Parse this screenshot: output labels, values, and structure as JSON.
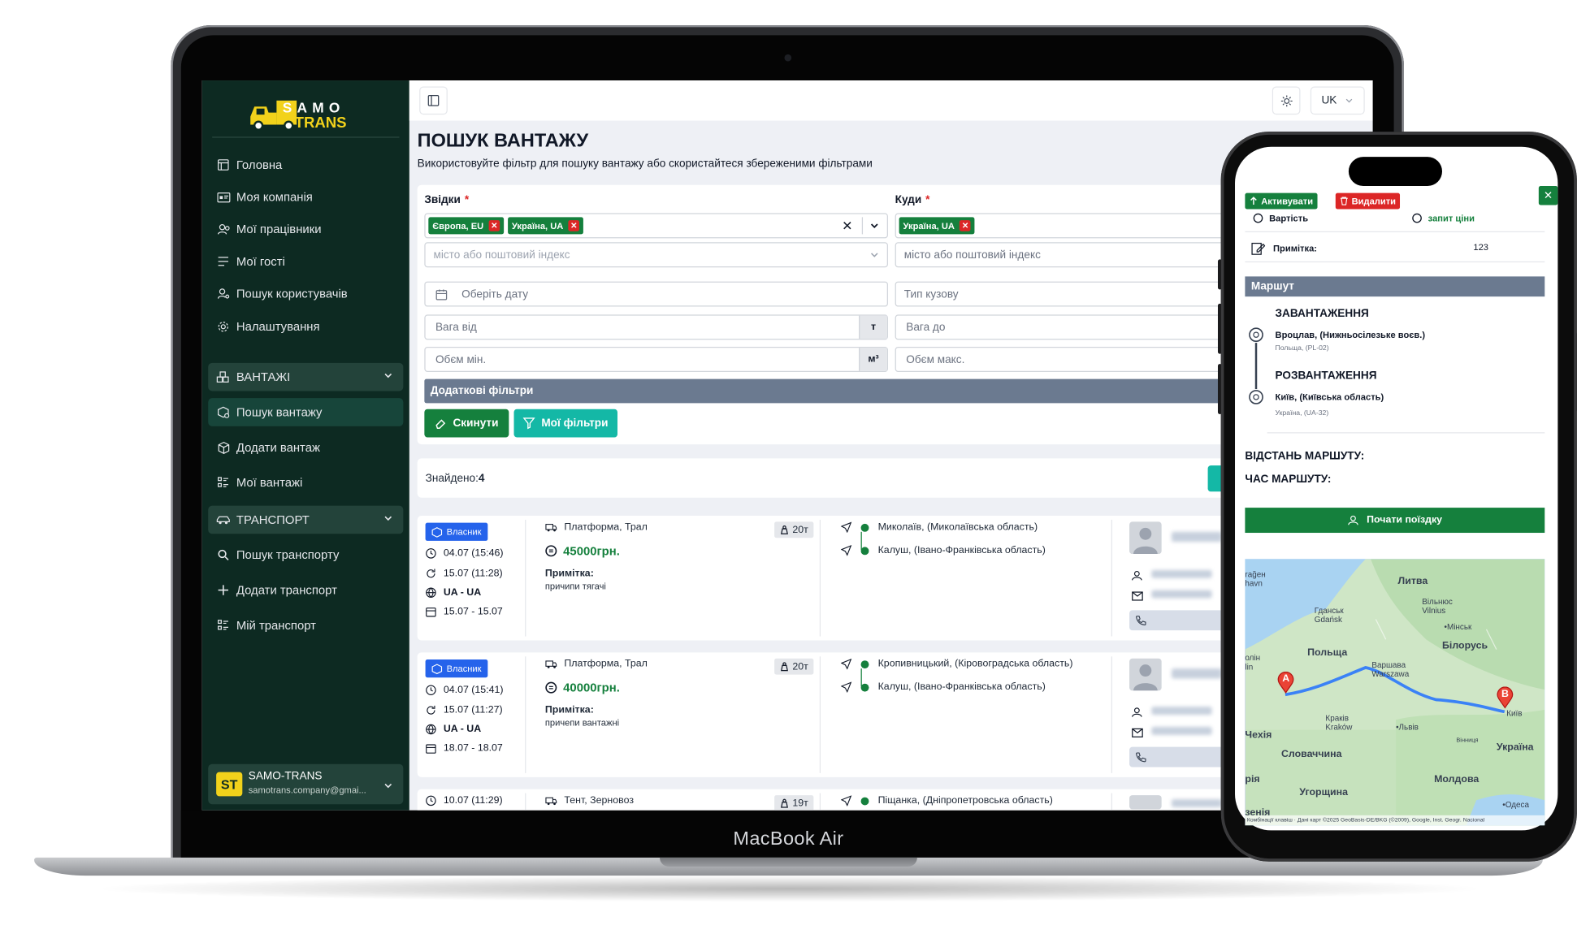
{
  "device": {
    "laptop_label": "MacBook Air"
  },
  "brand": {
    "line1": "SAMO",
    "line2": "TRANS"
  },
  "sidebar": {
    "items": [
      {
        "label": "Головна",
        "icon": "home-icon"
      },
      {
        "label": "Моя компанія",
        "icon": "id-card-icon"
      },
      {
        "label": "Мої працівники",
        "icon": "users-icon"
      },
      {
        "label": "Мої гості",
        "icon": "list-icon"
      },
      {
        "label": "Пошук користувачів",
        "icon": "user-search-icon"
      },
      {
        "label": "Налаштування",
        "icon": "gear-icon"
      }
    ],
    "groups": [
      {
        "label": "ВАНТАЖІ",
        "items": [
          {
            "label": "Пошук вантажу",
            "icon": "box-search-icon",
            "active": true
          },
          {
            "label": "Додати вантаж",
            "icon": "box-icon"
          },
          {
            "label": "Мої вантажі",
            "icon": "list-icon"
          }
        ]
      },
      {
        "label": "ТРАНСПОРТ",
        "items": [
          {
            "label": "Пошук транспорту",
            "icon": "search-icon"
          },
          {
            "label": "Додати транспорт",
            "icon": "plus-icon"
          },
          {
            "label": "Мій транспорт",
            "icon": "list-icon"
          }
        ]
      }
    ],
    "user": {
      "avatar": "ST",
      "name": "SAMO-TRANS",
      "email": "samotrans.company@gmai..."
    }
  },
  "topbar": {
    "language": "UK"
  },
  "page": {
    "title": "ПОШУК ВАНТАЖУ",
    "subtitle": "Використовуйте фільтр для пошуку вантажу або скористайтеся збереженими фільтрами"
  },
  "filters": {
    "from_label": "Звідки",
    "to_label": "Куди",
    "required_mark": "*",
    "from_chips": [
      "Європа, EU",
      "Україна, UA"
    ],
    "to_chips": [
      "Україна, UA"
    ],
    "city_placeholder": "місто або поштовий індекс",
    "date_placeholder": "Оберіть дату",
    "body_type_placeholder": "Тип кузову",
    "weight_from_placeholder": "Вага від",
    "weight_to_placeholder": "Вага до",
    "weight_unit": "т",
    "volume_min_placeholder": "Обєм мін.",
    "volume_max_placeholder": "Обєм макс.",
    "volume_unit": "м³",
    "extra_filters": "Додаткові фільтри",
    "reset_label": "Скинути",
    "my_filters_label": "Мої фільтри"
  },
  "results": {
    "found_label": "Знайдено:",
    "found_count": "4",
    "items": [
      {
        "badge": "Власник",
        "created": "04.07 (15:46)",
        "updated": "15.07 (11:28)",
        "countries": "UA - UA",
        "dates": "15.07 - 15.07",
        "type": "Платформа, Трал",
        "price": "45000грн.",
        "tonnage": "20т",
        "note_label": "Примітка:",
        "note": "причипи тягачі",
        "from": "Миколаїв, (Миколаївська область)",
        "to": "Калуш, (Івано-Франківська область)"
      },
      {
        "badge": "Власник",
        "created": "04.07 (15:41)",
        "updated": "15.07 (11:27)",
        "countries": "UA - UA",
        "dates": "18.07 - 18.07",
        "type": "Платформа, Трал",
        "price": "40000грн.",
        "tonnage": "20т",
        "note_label": "Примітка:",
        "note": "причепи вантажні",
        "from": "Кропивницький, (Кіровоградська область)",
        "to": "Калуш, (Івано-Франківська область)"
      },
      {
        "created": "10.07 (11:29)",
        "type": "Тент, Зерновоз",
        "tonnage": "19т",
        "from": "Піщанка, (Дніпропетровська область)"
      }
    ]
  },
  "phone": {
    "activate_label": "Активувати",
    "delete_label": "Видалити",
    "price_label": "Вартість",
    "price_value": "запит ціни",
    "note_label": "Примітка:",
    "note_value": "123",
    "route_section": "Маршут",
    "loading_title": "ЗАВАНТАЖЕННЯ",
    "loading_place": "Вроцлав, (Нижньосілезьке воєв.)",
    "loading_sub": "Польща, (PL-02)",
    "unloading_title": "РОЗВАНТАЖЕННЯ",
    "unloading_place": "Київ, (Київська область)",
    "unloading_sub": "Україна, (UA-32)",
    "distance_label": "ВІДСТАНЬ МАРШУТУ:",
    "time_label": "ЧАС МАРШУТУ:",
    "start_trip": "Почати поїздку",
    "map": {
      "labels": {
        "lithuania": "Литва",
        "vilnius1": "Вільнюс",
        "vilnius2": "Vilnius",
        "gdansk1": "Гданськ",
        "gdansk2": "Gdańsk",
        "minsk": "•Мінськ",
        "belarus": "Білорусь",
        "poland": "Польща",
        "warsaw1": "Варшава",
        "warsaw2": "Warszawa",
        "kyiv": "Київ",
        "krakow1": "Краків",
        "krakow2": "Kraków",
        "lviv": "•Львів",
        "vinnytsia": "Вінниця",
        "ukraine": "Україна",
        "czechia": "Чехія",
        "slovakia": "Словаччина",
        "hungary": "Угорщина",
        "moldova": "Молдова",
        "odesa": "•Одеса",
        "edge1": "rağeн",
        "edge2": "havn",
        "edge3": "олін",
        "edge4": "lin",
        "edge5": "рія",
        "edge6": "зенія"
      },
      "marker_a": "A",
      "marker_b": "B",
      "footer": "Комбінації клавіш · Дані карт ©2025 GeoBasis-DE/BKG (©2009), Google, Inst. Geogr. Nacional"
    }
  }
}
